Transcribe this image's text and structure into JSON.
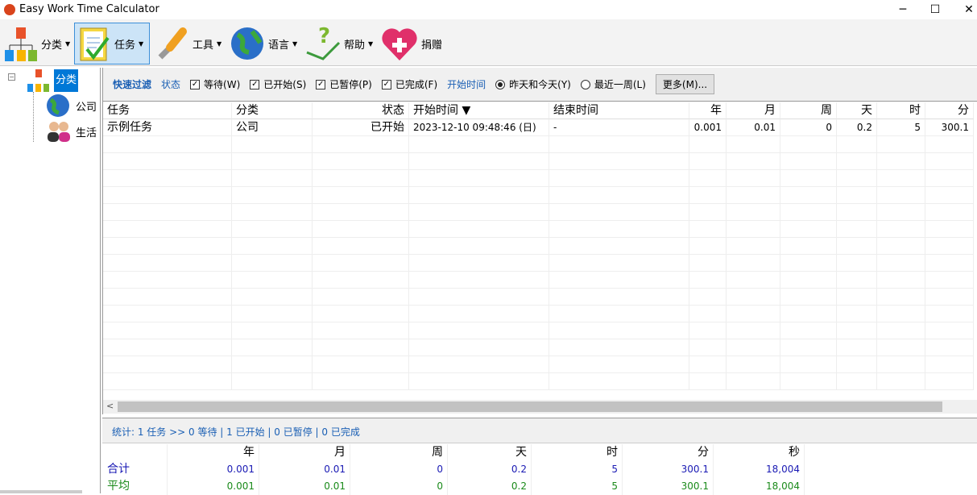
{
  "window": {
    "title": "Easy Work Time Calculator",
    "minimize": "─",
    "maximize": "☐",
    "close": "✕"
  },
  "toolbar": [
    {
      "label": "分类",
      "dropdown": true
    },
    {
      "label": "任务",
      "dropdown": true,
      "selected": true
    },
    {
      "label": "工具",
      "dropdown": true
    },
    {
      "label": "语言",
      "dropdown": true
    },
    {
      "label": "帮助",
      "dropdown": true
    },
    {
      "label": "捐赠",
      "dropdown": false
    }
  ],
  "tree": {
    "root": "分类",
    "children": [
      "公司",
      "生活"
    ]
  },
  "filter": {
    "quick": "快速过滤",
    "status_label": "状态",
    "checks": [
      {
        "label": "等待(W)",
        "checked": true
      },
      {
        "label": "已开始(S)",
        "checked": true
      },
      {
        "label": "已暂停(P)",
        "checked": true
      },
      {
        "label": "已完成(F)",
        "checked": true
      }
    ],
    "time_label": "开始时间",
    "radios": [
      {
        "label": "昨天和今天(Y)",
        "selected": true
      },
      {
        "label": "最近一周(L)",
        "selected": false
      }
    ],
    "more": "更多(M)..."
  },
  "table": {
    "columns": [
      "任务",
      "分类",
      "状态",
      "开始时间 ▼",
      "结束时间",
      "年",
      "月",
      "周",
      "天",
      "时",
      "分"
    ],
    "rows": [
      [
        "示例任务",
        "公司",
        "已开始",
        "2023-12-10 09:48:46 (日)",
        "-",
        "0.001",
        "0.01",
        "0",
        "0.2",
        "5",
        "300.1"
      ]
    ]
  },
  "stats": "统计: 1 任务 >> 0 等待 | 1 已开始 | 0 已暂停 | 0 已完成",
  "summary": {
    "columns": [
      "",
      "年",
      "月",
      "周",
      "天",
      "时",
      "分",
      "秒"
    ],
    "rows": [
      {
        "label": "合计",
        "values": [
          "0.001",
          "0.01",
          "0",
          "0.2",
          "5",
          "300.1",
          "18,004"
        ],
        "color": "#1a1ab4"
      },
      {
        "label": "平均",
        "values": [
          "0.001",
          "0.01",
          "0",
          "0.2",
          "5",
          "300.1",
          "18,004"
        ],
        "color": "#1a8a1a"
      }
    ]
  }
}
